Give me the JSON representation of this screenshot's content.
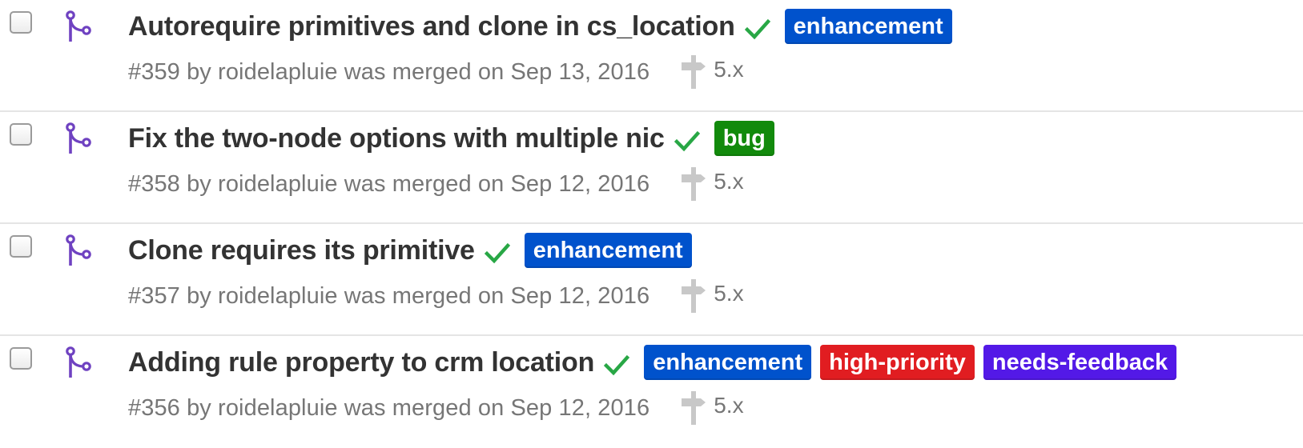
{
  "pull_requests": [
    {
      "title": "Autorequire primitives and clone in cs_location",
      "labels": [
        {
          "name": "enhancement",
          "color": "#0052cc"
        }
      ],
      "meta": "#359 by roidelapluie was merged on Sep 13, 2016",
      "milestone": "5.x"
    },
    {
      "title": "Fix the two-node options with multiple nic",
      "labels": [
        {
          "name": "bug",
          "color": "#128a0c"
        }
      ],
      "meta": "#358 by roidelapluie was merged on Sep 12, 2016",
      "milestone": "5.x"
    },
    {
      "title": "Clone requires its primitive",
      "labels": [
        {
          "name": "enhancement",
          "color": "#0052cc"
        }
      ],
      "meta": "#357 by roidelapluie was merged on Sep 12, 2016",
      "milestone": "5.x"
    },
    {
      "title": "Adding rule property to crm location",
      "labels": [
        {
          "name": "enhancement",
          "color": "#0052cc"
        },
        {
          "name": "high-priority",
          "color": "#e11d21"
        },
        {
          "name": "needs-feedback",
          "color": "#5319e7"
        }
      ],
      "meta": "#356 by roidelapluie was merged on Sep 12, 2016",
      "milestone": "5.x"
    }
  ],
  "icons": {
    "pr_icon": "git-merge-icon",
    "status_icon": "check-icon",
    "milestone_icon": "milestone-icon"
  },
  "colors": {
    "merge_icon": "#6f42c1",
    "check": "#28a745",
    "meta_text": "#767676",
    "title_text": "#333333"
  }
}
